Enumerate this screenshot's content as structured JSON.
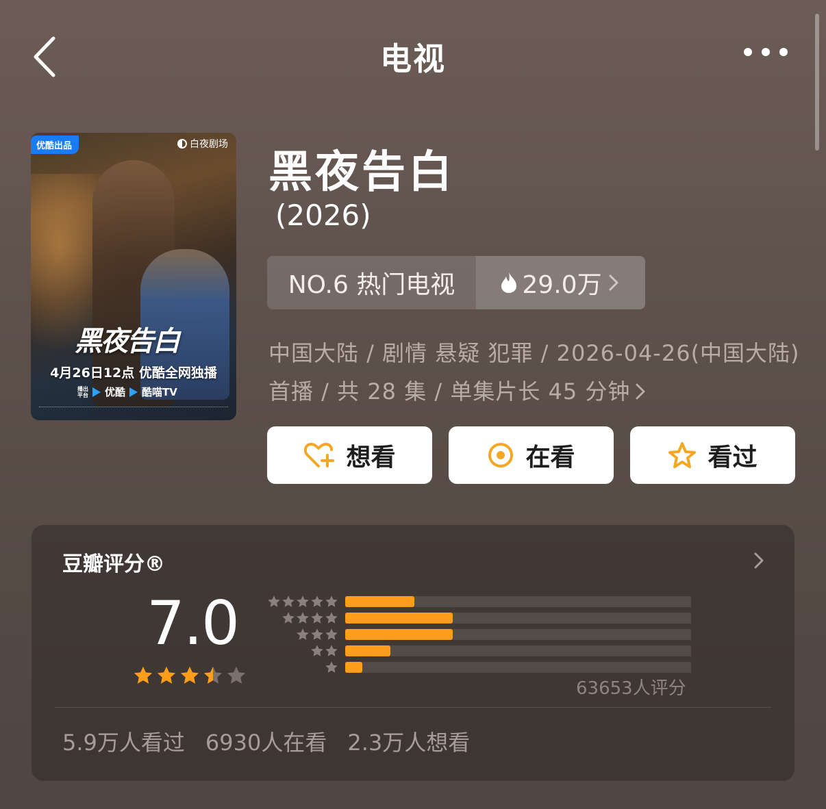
{
  "header": {
    "title": "电视"
  },
  "poster": {
    "badge": "优酷出品",
    "brand": "白夜剧场",
    "calligraphy_title": "黑夜告白",
    "date_line": "4月26日12点 优酷全网独播",
    "platform_caption": "播出平台",
    "platform_1": "优酷",
    "platform_2": "酷喵TV"
  },
  "show": {
    "title": "黑夜告白",
    "year": "(2026)",
    "rank_label": "NO.6 热门电视",
    "heat": "29.0万",
    "meta_line1": "中国大陆 / 剧情 悬疑 犯罪 / 2026-04-26(中国大陆)",
    "meta_line2": "首播 / 共 28 集 / 单集片长 45 分钟"
  },
  "actions": [
    {
      "label": "想看",
      "icon": "heart-plus-icon"
    },
    {
      "label": "在看",
      "icon": "target-circle-icon"
    },
    {
      "label": "看过",
      "icon": "star-outline-icon"
    }
  ],
  "rating": {
    "title": "豆瓣评分®",
    "score": "7.0",
    "stars_value": 3.5,
    "distribution": [
      {
        "stars": 5,
        "fraction": 0.2
      },
      {
        "stars": 4,
        "fraction": 0.31
      },
      {
        "stars": 3,
        "fraction": 0.31
      },
      {
        "stars": 2,
        "fraction": 0.13
      },
      {
        "stars": 1,
        "fraction": 0.05
      }
    ],
    "count": "63653人评分",
    "watched": "5.9万人看过",
    "watching": "6930人在看",
    "want": "2.3万人想看"
  },
  "colors": {
    "accent": "#ff9e1a",
    "star_gray": "#7a716c"
  }
}
